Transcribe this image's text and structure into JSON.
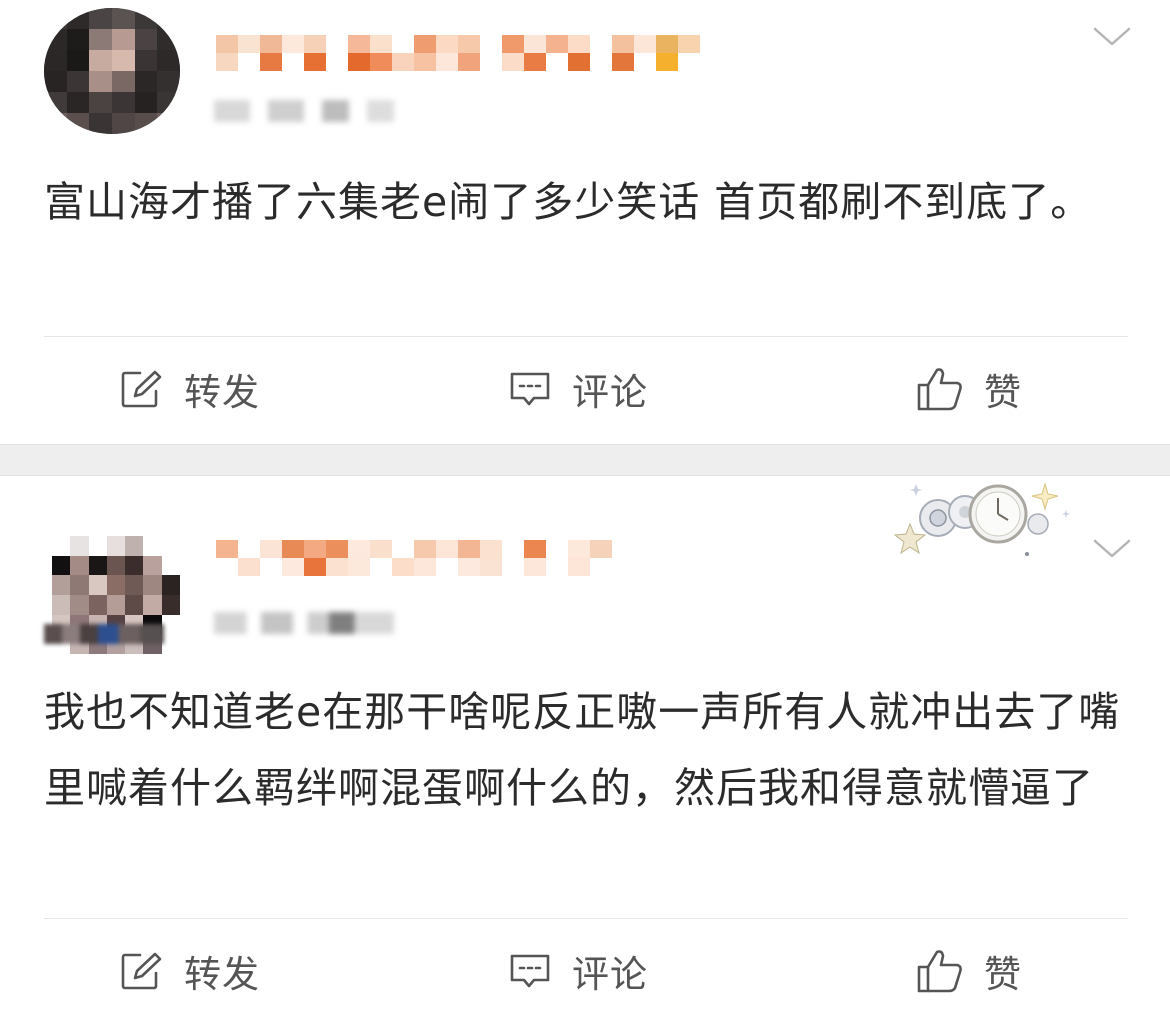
{
  "posts": [
    {
      "content": "富山海才播了六集老e闹了多少笑话 首页都刷不到底了。",
      "actions": {
        "repost_label": "转发",
        "comment_label": "评论",
        "like_label": "赞"
      }
    },
    {
      "content": "我也不知道老e在那干啥呢反正嗷一声所有人就冲出去了嘴里喊着什么羁绊啊混蛋啊什么的，然后我和得意就懵逼了",
      "actions": {
        "repost_label": "转发",
        "comment_label": "评论",
        "like_label": "赞"
      }
    }
  ],
  "icons": {
    "repost": "edit-square-icon",
    "comment": "comment-bubble-icon",
    "like": "thumbs-up-icon",
    "menu": "chevron-down-icon"
  },
  "colors": {
    "text": "#2b2b2b",
    "action_text": "#555555",
    "separator": "#eeeeee",
    "nickname_mosaic": "#e07a3a"
  }
}
